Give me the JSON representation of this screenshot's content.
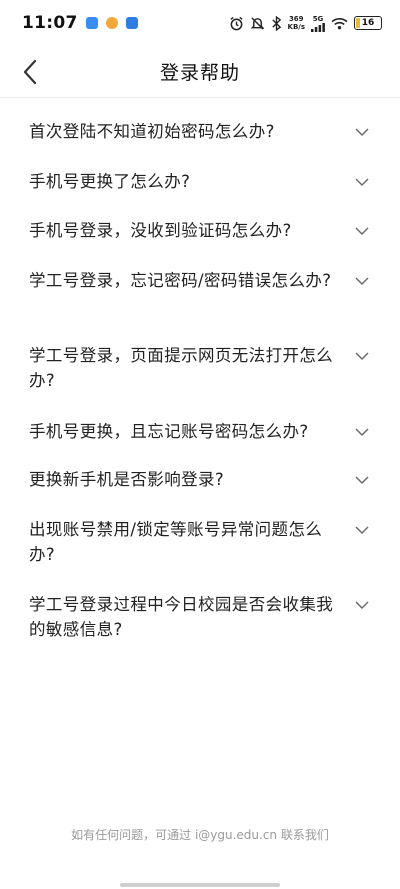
{
  "status_bar": {
    "time": "11:07",
    "speed_top": "369",
    "speed_unit": "KB/s",
    "network": "5G",
    "battery": "16"
  },
  "header": {
    "title": "登录帮助"
  },
  "faq": [
    {
      "q": "首次登陆不知道初始密码怎么办?"
    },
    {
      "q": "手机号更换了怎么办?"
    },
    {
      "q": "手机号登录，没收到验证码怎么办?"
    },
    {
      "q": "学工号登录，忘记密码/密码错误怎么办?"
    },
    {
      "q": "学工号登录，页面提示网页无法打开怎么办?"
    },
    {
      "q": "手机号更换，且忘记账号密码怎么办?"
    },
    {
      "q": "更换新手机是否影响登录?"
    },
    {
      "q": "出现账号禁用/锁定等账号异常问题怎么办?"
    },
    {
      "q": "学工号登录过程中今日校园是否会收集我的敏感信息?"
    }
  ],
  "footer": {
    "contact": "如有任何问题，可通过 i@ygu.edu.cn 联系我们"
  }
}
